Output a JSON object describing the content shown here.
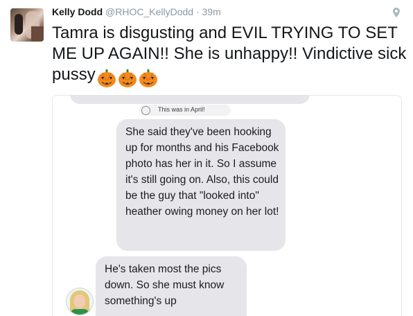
{
  "tweet": {
    "name": "Kelly Dodd",
    "handle": "@RHOC_KellyDodd",
    "separator": "·",
    "time": "39m",
    "text": "Tamra is disgusting and EVIL TRYING TO SET ME UP AGAIN!! She is unhappy!! Vindictive sick pussy",
    "emoji": "jack-o-lantern"
  },
  "screenshot": {
    "notice": "This was in April!",
    "message1": "She said they've been hooking up for months and his Facebook photo has her in it. So I assume it's still going on. Also, this could be the guy that \"looked into\" heather owing money on her lot!",
    "message2": "He's taken most the pics down. So she must know something's up"
  },
  "colors": {
    "accent": "#f28a1e",
    "bubble": "#e5e5ea",
    "muted": "#8899a6"
  }
}
